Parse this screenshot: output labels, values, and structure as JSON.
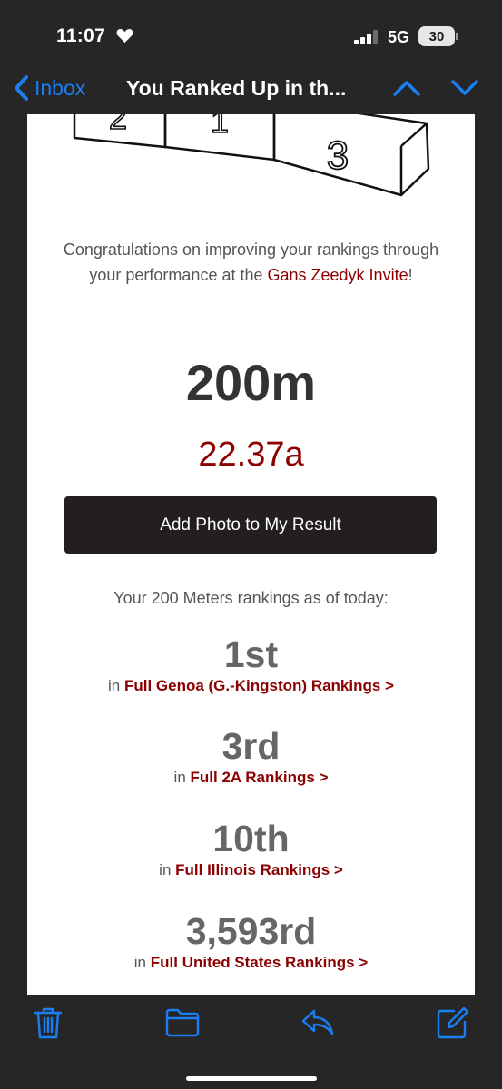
{
  "status_bar": {
    "time": "11:07",
    "network": "5G",
    "battery": "30"
  },
  "nav": {
    "back_label": "Inbox",
    "title": "You Ranked Up in th..."
  },
  "email": {
    "podium_numbers": [
      "2",
      "1",
      "3"
    ],
    "intro_text": "Congratulations on improving your rankings through your performance at the ",
    "meet_name": "Gans Zeedyk Invite",
    "intro_end": "!",
    "event": "200m",
    "mark": "22.37a",
    "photo_button": "Add Photo to My Result",
    "rankings_heading": "Your 200 Meters rankings as of today:",
    "rankings": [
      {
        "rank": "1st",
        "prefix": "in ",
        "link": "Full Genoa (G.-Kingston) Rankings >"
      },
      {
        "rank": "3rd",
        "prefix": "in ",
        "link": "Full 2A Rankings >"
      },
      {
        "rank": "10th",
        "prefix": "in ",
        "link": "Full Illinois Rankings >"
      },
      {
        "rank": "3,593rd",
        "prefix": "in ",
        "link": "Full United States Rankings >"
      }
    ]
  },
  "colors": {
    "accent_ios": "#1a7ff5",
    "accent_brand": "#8b0000",
    "button_dark": "#231f1f"
  },
  "icons": [
    "heart-icon",
    "signal-icon",
    "chevron-left-icon",
    "chevron-up-icon",
    "chevron-down-icon",
    "trash-icon",
    "folder-icon",
    "reply-icon",
    "compose-icon"
  ]
}
